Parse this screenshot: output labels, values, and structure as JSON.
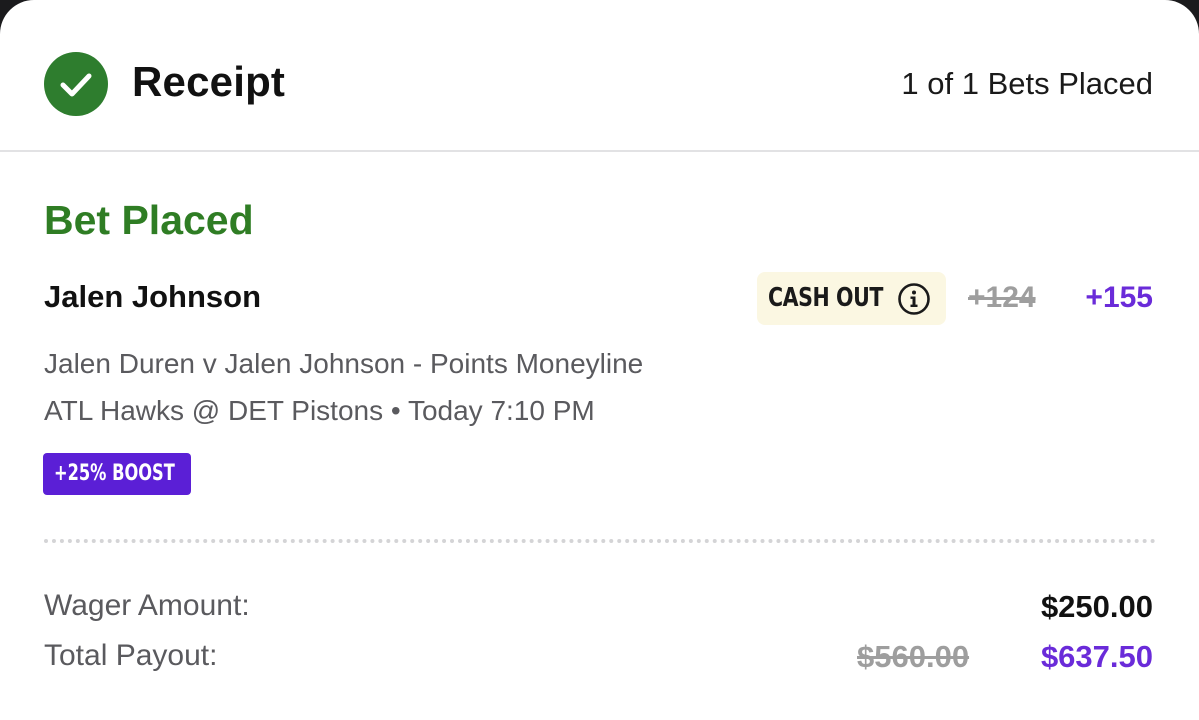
{
  "header": {
    "title": "Receipt",
    "bets_placed": "1 of 1 Bets Placed"
  },
  "bet": {
    "status": "Bet Placed",
    "selection": "Jalen Johnson",
    "cash_out_label": "CASH OUT",
    "original_odds": "+124",
    "boosted_odds": "+155",
    "market": "Jalen Duren v Jalen Johnson - Points Moneyline",
    "event": "ATL Hawks @ DET Pistons • Today 7:10 PM",
    "boost_badge": "+25% BOOST"
  },
  "summary": {
    "wager_label": "Wager Amount:",
    "wager_value": "$250.00",
    "payout_label": "Total Payout:",
    "original_payout": "$560.00",
    "boosted_payout": "$637.50"
  },
  "colors": {
    "success_green": "#2f7d24",
    "boost_purple": "#5b1fd6",
    "odds_purple": "#6a2bd9"
  },
  "icons": {
    "status": "check-circle-icon",
    "cash_out_info": "info-icon"
  }
}
